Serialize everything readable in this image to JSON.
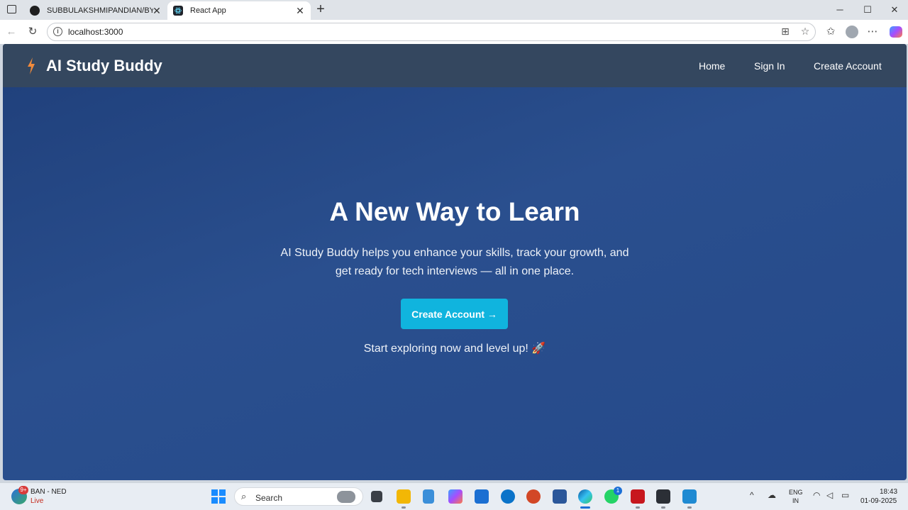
{
  "browser": {
    "tabs": [
      {
        "title": "SUBBULAKSHMIPANDIAN/BYTES",
        "favicon": "github-icon"
      },
      {
        "title": "React App",
        "favicon": "react-icon"
      }
    ],
    "new_tab_glyph": "+",
    "window_controls": {
      "minimize": "─",
      "maximize": "☐",
      "close": "✕"
    },
    "close_tab_glyph": "✕",
    "url": "localhost:3000",
    "info_glyph": "i"
  },
  "app": {
    "brand": "AI Study Buddy",
    "nav": {
      "home": "Home",
      "signin": "Sign In",
      "create": "Create Account"
    },
    "hero": {
      "title": "A New Way to Learn",
      "subtitle": "AI Study Buddy helps you enhance your skills, track your growth, and get ready for tech interviews — all in one place.",
      "cta": "Create Account →",
      "tagline": "Start exploring now and level up! 🚀"
    },
    "colors": {
      "nav_bg": "#34475f",
      "hero_bg": "#2a4f8e",
      "cta_bg": "#10b4de",
      "logo": "#f08a3c"
    }
  },
  "taskbar": {
    "weather": {
      "label": "BAN - NED",
      "status": "Live",
      "badge": "9+"
    },
    "search_placeholder": "Search",
    "whatsapp_badge": "1",
    "lang": {
      "line1": "ENG",
      "line2": "IN"
    },
    "clock": {
      "time": "18:43",
      "date": "01-09-2025"
    }
  }
}
